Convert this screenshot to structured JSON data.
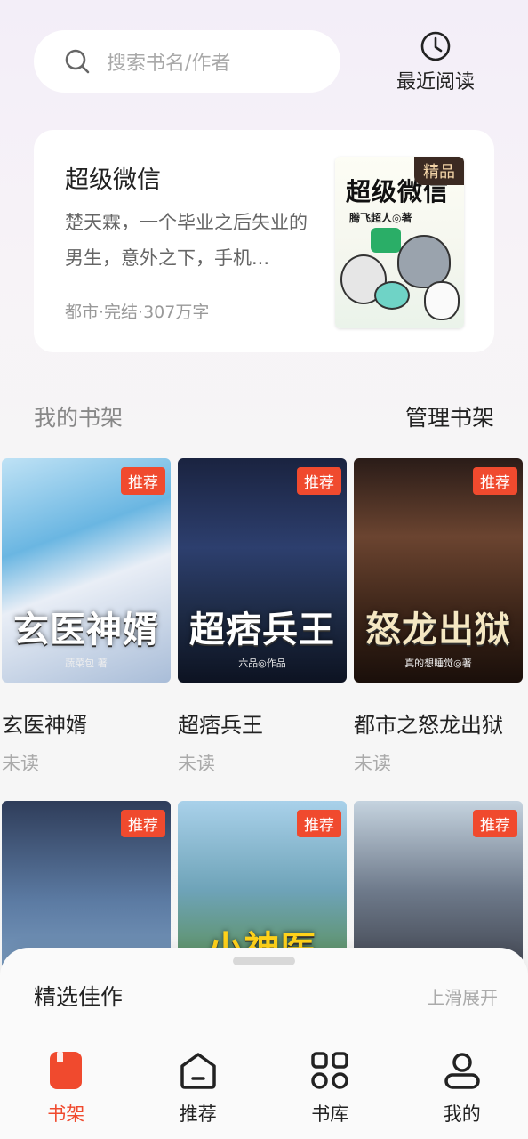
{
  "search": {
    "placeholder": "搜索书名/作者"
  },
  "recent": {
    "label": "最近阅读"
  },
  "featured": {
    "title": "超级微信",
    "description": "楚天霖，一个毕业之后失业的男生，意外之下，手机...",
    "meta": "都市·完结·307万字",
    "badge": "精品",
    "cover_title": "超级微信",
    "cover_author": "腾飞超人◎著"
  },
  "shelf": {
    "title": "我的书架",
    "manage_label": "管理书架"
  },
  "books": [
    {
      "name": "玄医神婿",
      "status": "未读",
      "badge": "推荐",
      "cover_text": "玄医神婿",
      "cover_sub": "蔬菜包 著"
    },
    {
      "name": "超痞兵王",
      "status": "未读",
      "badge": "推荐",
      "cover_text": "超痞兵王",
      "cover_sub": "六品◎作品"
    },
    {
      "name": "都市之怒龙出狱",
      "status": "未读",
      "badge": "推荐",
      "cover_text": "怒龙出狱",
      "cover_sub": "真的想睡觉◎著"
    },
    {
      "name": "",
      "status": "",
      "badge": "推荐",
      "cover_text": "",
      "cover_sub": ""
    },
    {
      "name": "",
      "status": "",
      "badge": "推荐",
      "cover_text": "小神医",
      "cover_sub": ""
    },
    {
      "name": "",
      "status": "",
      "badge": "推荐",
      "cover_text": "",
      "cover_sub": ""
    }
  ],
  "sheet": {
    "title": "精选佳作",
    "hint": "上滑展开"
  },
  "tabs": [
    {
      "label": "书架",
      "icon": "bookshelf-icon",
      "active": true
    },
    {
      "label": "推荐",
      "icon": "home-icon",
      "active": false
    },
    {
      "label": "书库",
      "icon": "grid-icon",
      "active": false
    },
    {
      "label": "我的",
      "icon": "user-icon",
      "active": false
    }
  ],
  "colors": {
    "accent": "#f04a2e",
    "badge_dark": "#3b2a22"
  }
}
